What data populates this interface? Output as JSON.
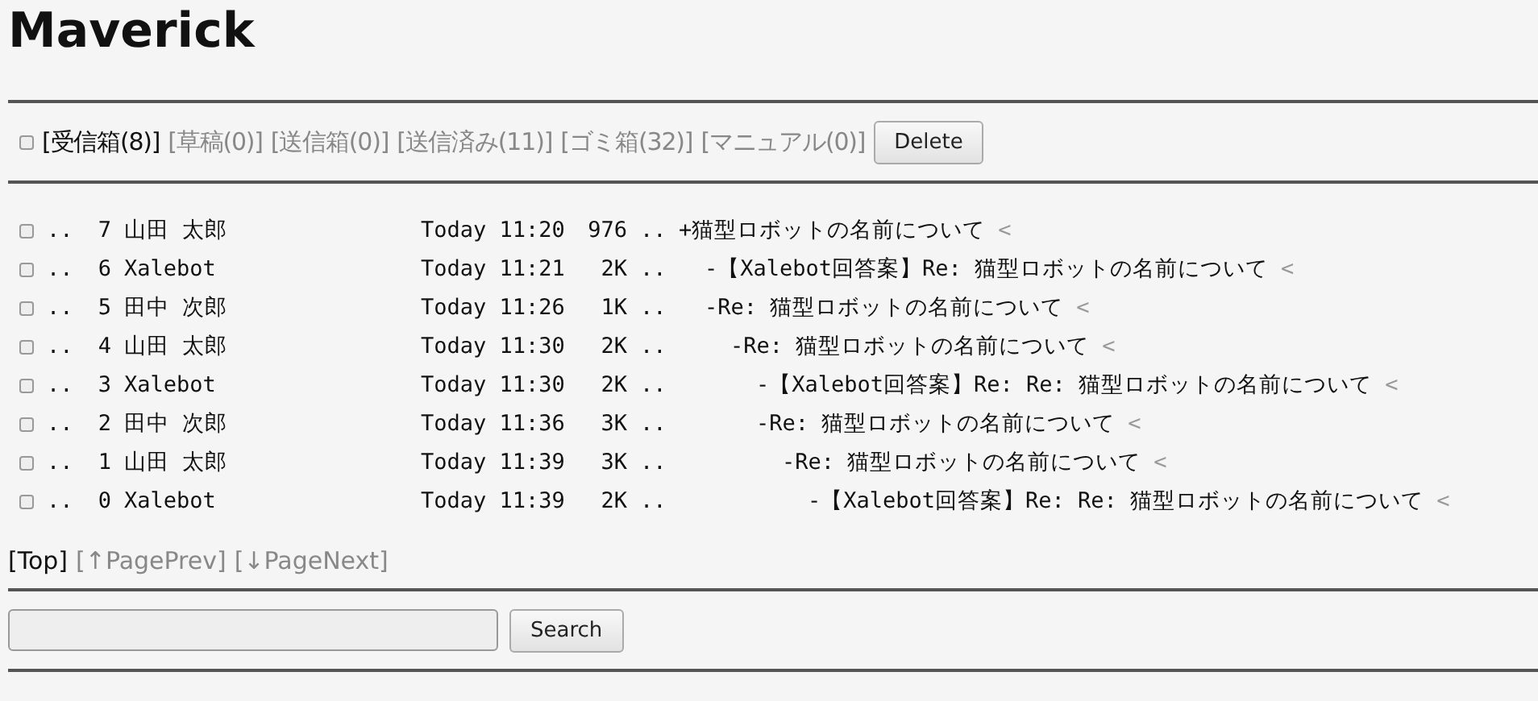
{
  "title": "Maverick",
  "toolbar": {
    "select_all": {
      "checked": false
    },
    "folders": [
      {
        "label": "[受信箱(8)]",
        "selected": true
      },
      {
        "label": "[草稿(0)]",
        "selected": false
      },
      {
        "label": "[送信箱(0)]",
        "selected": false
      },
      {
        "label": "[送信済み(11)]",
        "selected": false
      },
      {
        "label": "[ゴミ箱(32)]",
        "selected": false
      },
      {
        "label": "[マニュアル(0)]",
        "selected": false
      }
    ],
    "delete_button": "Delete"
  },
  "messages": [
    {
      "checked": false,
      "dots": "..",
      "number": "7",
      "sender": "山田 太郎",
      "date": "Today 11:20",
      "size": "976",
      "dots2": "..",
      "mark": "+",
      "subject": "猫型ロボットの名前について",
      "link": "<",
      "children": [
        {
          "checked": false,
          "dots": "..",
          "number": "6",
          "sender": "Xalebot",
          "date": "Today 11:21",
          "size": "2K",
          "dots2": "..",
          "mark": "-",
          "subject": "【Xalebot回答案】Re: 猫型ロボットの名前について",
          "link": "<"
        },
        {
          "checked": false,
          "dots": "..",
          "number": "5",
          "sender": "田中 次郎",
          "date": "Today 11:26",
          "size": "1K",
          "dots2": "..",
          "mark": "-",
          "subject": "Re: 猫型ロボットの名前について",
          "link": "<",
          "children": [
            {
              "checked": false,
              "dots": "..",
              "number": "4",
              "sender": "山田 太郎",
              "date": "Today 11:30",
              "size": "2K",
              "dots2": "..",
              "mark": "-",
              "subject": "Re: 猫型ロボットの名前について",
              "link": "<",
              "children": [
                {
                  "checked": false,
                  "dots": "..",
                  "number": "3",
                  "sender": "Xalebot",
                  "date": "Today 11:30",
                  "size": "2K",
                  "dots2": "..",
                  "mark": "-",
                  "subject": "【Xalebot回答案】Re: Re: 猫型ロボットの名前について",
                  "link": "<"
                },
                {
                  "checked": false,
                  "dots": "..",
                  "number": "2",
                  "sender": "田中 次郎",
                  "date": "Today 11:36",
                  "size": "3K",
                  "dots2": "..",
                  "mark": "-",
                  "subject": "Re: 猫型ロボットの名前について",
                  "link": "<",
                  "children": [
                    {
                      "checked": false,
                      "dots": "..",
                      "number": "1",
                      "sender": "山田 太郎",
                      "date": "Today 11:39",
                      "size": "3K",
                      "dots2": "..",
                      "mark": "-",
                      "subject": "Re: 猫型ロボットの名前について",
                      "link": "<",
                      "children": [
                        {
                          "checked": false,
                          "dots": "..",
                          "number": "0",
                          "sender": "Xalebot",
                          "date": "Today 11:39",
                          "size": "2K",
                          "dots2": "..",
                          "mark": "-",
                          "subject": "【Xalebot回答案】Re: Re: 猫型ロボットの名前について",
                          "link": "<"
                        }
                      ]
                    }
                  ]
                }
              ]
            }
          ]
        }
      ]
    }
  ],
  "pager": [
    {
      "label": "[Top]",
      "disabled": false
    },
    {
      "label": "[↑PagePrev]",
      "disabled": true
    },
    {
      "label": "[↓PageNext]",
      "disabled": true
    }
  ],
  "search": {
    "button": "Search"
  }
}
